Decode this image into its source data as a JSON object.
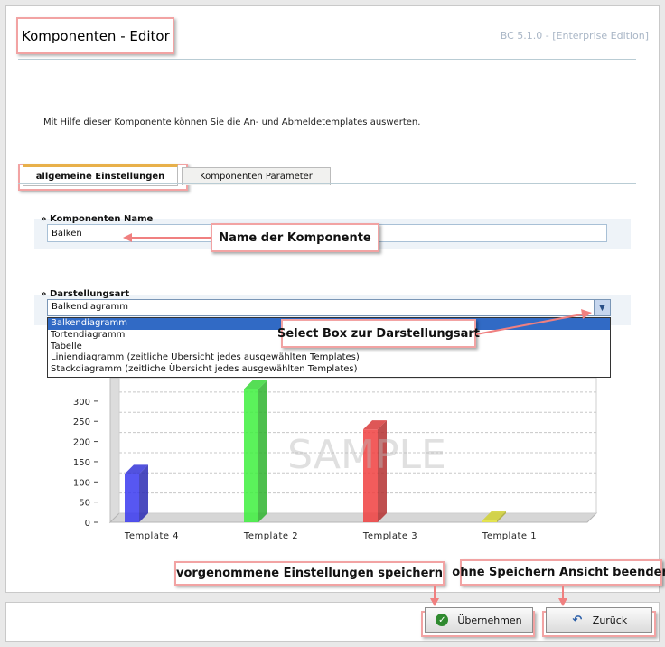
{
  "header": {
    "title": "Komponenten - Editor",
    "version": "BC 5.1.0 - [Enterprise Edition]"
  },
  "intro": "Mit Hilfe dieser Komponente können Sie die An- und Abmeldetemplates auswerten.",
  "tabs": [
    {
      "label": "allgemeine Einstellungen",
      "active": true
    },
    {
      "label": "Komponenten Parameter",
      "active": false
    }
  ],
  "name_section": {
    "title": "» Komponenten Name",
    "value": "Balken"
  },
  "display_section": {
    "title": "» Darstellungsart",
    "selected": "Balkendiagramm",
    "options": [
      "Balkendiagramm",
      "Tortendiagramm",
      "Tabelle",
      "Liniendiagramm (zeitliche Übersicht jedes ausgewählten Templates)",
      "Stackdiagramm (zeitliche Übersicht jedes ausgewählten Templates)"
    ]
  },
  "callouts": {
    "name": "Name der Komponente",
    "select": "Select Box zur Darstellungsart",
    "save": "vorgenommene Einstellungen speichern",
    "back": "ohne Speichern Ansicht beenden"
  },
  "buttons": {
    "save": "Übernehmen",
    "back": "Zurück"
  },
  "icons": {
    "save": "check-icon",
    "back": "undo-arrow-icon",
    "select": "chevron-down-icon"
  },
  "colors": {
    "highlight": "#f2a3a3",
    "selection": "#316ac5",
    "tab_accent": "#e8b04a"
  },
  "chart_data": {
    "type": "bar",
    "categories": [
      "Template 4",
      "Template 2",
      "Template 3",
      "Template 1"
    ],
    "values": [
      120,
      330,
      230,
      5
    ],
    "colors": [
      "#3a3af0",
      "#3ef03e",
      "#f04040",
      "#e8e83a"
    ],
    "yticks": [
      0,
      50,
      100,
      150,
      200,
      250,
      300
    ],
    "ylim": [
      0,
      340
    ],
    "watermark": "SAMPLE",
    "grid": true
  }
}
